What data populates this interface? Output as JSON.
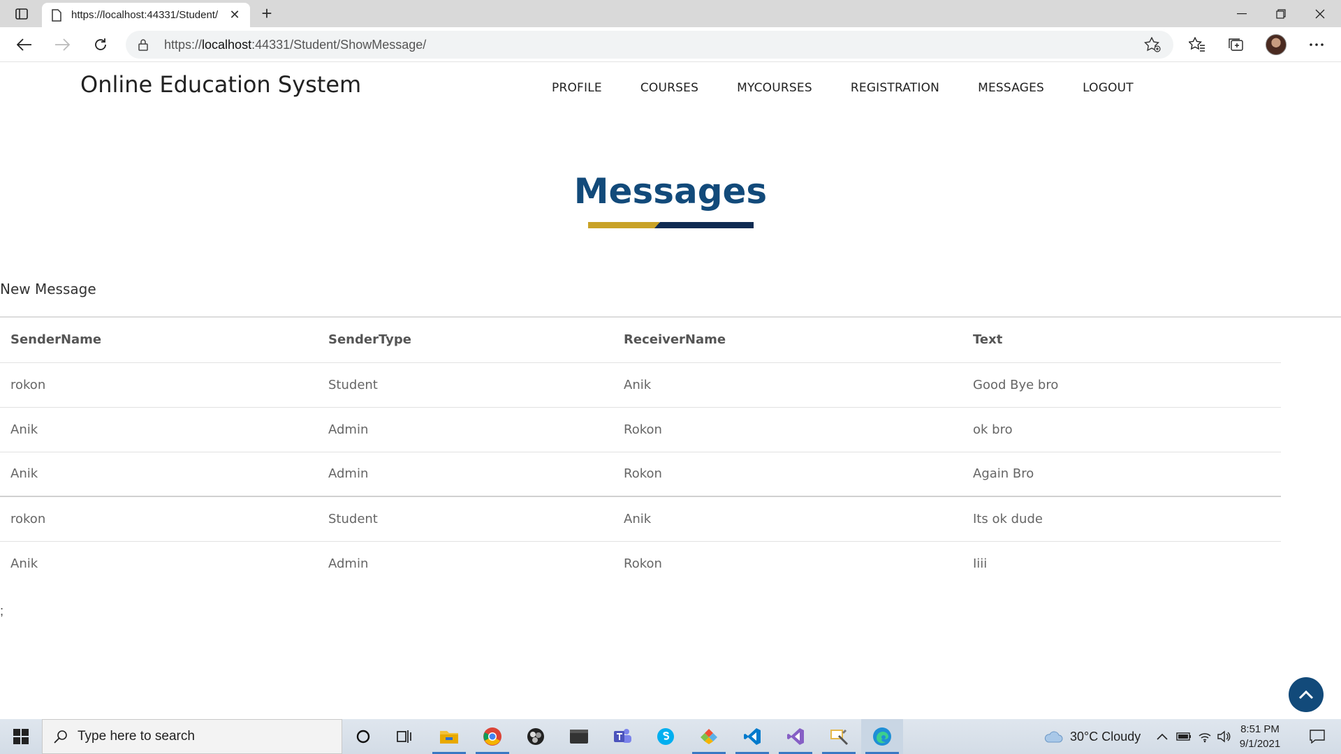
{
  "browser": {
    "tab_title": "https://localhost:44331/Student/",
    "tab_close": "✕",
    "newtab": "+",
    "url_scheme": "https://",
    "url_host": "localhost",
    "url_rest": ":44331/Student/ShowMessage/"
  },
  "site": {
    "brand": "Online Education System",
    "nav": [
      "PROFILE",
      "COURSES",
      "MYCOURSES",
      "REGISTRATION",
      "MESSAGES",
      "LOGOUT"
    ]
  },
  "main": {
    "section_title": "Messages",
    "new_message_link": "New Message",
    "stray_text": ";",
    "table": {
      "headers": [
        "SenderName",
        "SenderType",
        "ReceiverName",
        "Text"
      ],
      "rows": [
        [
          "rokon",
          "Student",
          "Anik",
          "Good Bye bro"
        ],
        [
          "Anik",
          "Admin",
          "Rokon",
          "ok bro"
        ],
        [
          "Anik",
          "Admin",
          "Rokon",
          "Again Bro"
        ],
        [
          "rokon",
          "Student",
          "Anik",
          "Its ok dude"
        ],
        [
          "Anik",
          "Admin",
          "Rokon",
          "Iiii"
        ]
      ]
    }
  },
  "taskbar": {
    "search_placeholder": "Type here to search",
    "weather": "30°C  Cloudy",
    "time": "8:51 PM",
    "date": "9/1/2021",
    "apps": [
      "cortana-icon",
      "task-view-icon",
      "file-explorer-icon",
      "chrome-icon",
      "obs-icon",
      "terminal-icon",
      "teams-icon",
      "skype-icon",
      "git-icon",
      "vscode-icon",
      "visual-studio-icon",
      "tool-icon",
      "edge-icon"
    ]
  },
  "colors": {
    "heading": "#124a7a",
    "underline_gold": "#c9a227",
    "underline_navy": "#0f2b52",
    "back_to_top": "#124a7a"
  }
}
